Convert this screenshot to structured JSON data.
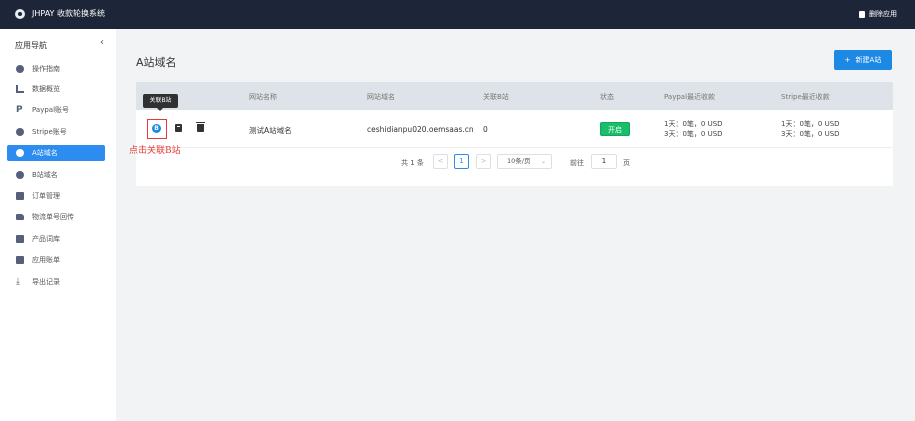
{
  "topbar": {
    "app_title": "JHPAY 收款轮换系统",
    "delete_app_label": "删除应用"
  },
  "sidebar": {
    "heading": "应用导航",
    "collapse_glyph": "‹",
    "items": [
      {
        "label": "操作指南",
        "icon": "circle-check-icon"
      },
      {
        "label": "数据概览",
        "icon": "bar-chart-icon"
      },
      {
        "label": "Paypal账号",
        "icon": "paypal-icon"
      },
      {
        "label": "Stripe账号",
        "icon": "stripe-icon"
      },
      {
        "label": "A站域名",
        "icon": "a-circle-icon",
        "active": true
      },
      {
        "label": "B站域名",
        "icon": "b-circle-icon"
      },
      {
        "label": "订单管理",
        "icon": "order-icon"
      },
      {
        "label": "物流单号回传",
        "icon": "truck-icon"
      },
      {
        "label": "产品词库",
        "icon": "book-icon"
      },
      {
        "label": "应用账单",
        "icon": "bill-icon"
      },
      {
        "label": "导出记录",
        "icon": "download-icon"
      }
    ]
  },
  "main": {
    "title": "A站域名",
    "new_button_label": "新建A站",
    "new_button_glyph": "+",
    "table": {
      "headers": [
        "网站名称",
        "网站域名",
        "关联B站",
        "状态",
        "Paypal最近收款",
        "Stripe最近收款"
      ],
      "rows": [
        {
          "name": "测试A站域名",
          "domain": "ceshidianpu020.oemsaas.cn",
          "linked_b": "0",
          "status": "开启",
          "paypal_recent": [
            "1天：0笔，0 USD",
            "3天：0笔，0 USD"
          ],
          "stripe_recent": [
            "1天：0笔，0 USD",
            "3天：0笔，0 USD"
          ]
        }
      ],
      "tooltip": "关联B站",
      "b_icon_glyph": "B"
    },
    "pagination": {
      "total": "共 1 条",
      "prev": "<",
      "current_page": "1",
      "next": ">",
      "page_size": "10条/页",
      "goto_label": "前往",
      "goto_value": "1",
      "page_suffix": "页"
    }
  },
  "annotation": "点击关联B站",
  "colors": {
    "topbar": "#1d2538",
    "accent": "#2d8cf0",
    "status_on": "#19be6b",
    "annotation": "#e53935"
  }
}
